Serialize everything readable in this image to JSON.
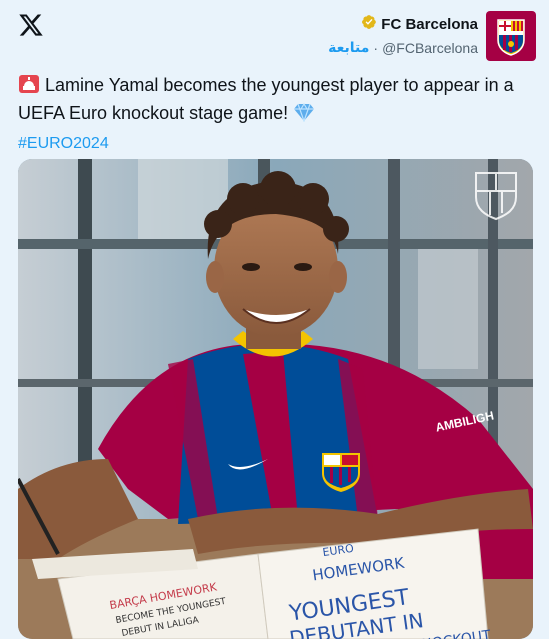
{
  "account": {
    "name": "FC Barcelona",
    "handle": "@FCBarcelona",
    "follow_label": "متابعة",
    "separator": "·"
  },
  "tweet": {
    "text": "Lamine Yamal becomes the youngest player to appear in a UEFA Euro knockout stage game!",
    "hashtag": "#EURO2024",
    "emoji_start": "siren",
    "emoji_end": "gem"
  },
  "media": {
    "shirt_sponsor": "AMBILIGH",
    "notebook_left_title": "BARÇA HOMEWORK",
    "notebook_left_line1": "BECOME THE YOUNGEST",
    "notebook_left_line2": "DEBUT IN LALIGA",
    "notebook_right_header1": "EURO",
    "notebook_right_header2": "HOMEWORK",
    "notebook_right_line1": "YOUNGEST",
    "notebook_right_line2": "DEBUTANT IN",
    "notebook_right_line3": "KNOCKOUT"
  },
  "colors": {
    "accent": "#1d9bf0",
    "barca_red": "#a50044",
    "barca_blue": "#004d98"
  }
}
